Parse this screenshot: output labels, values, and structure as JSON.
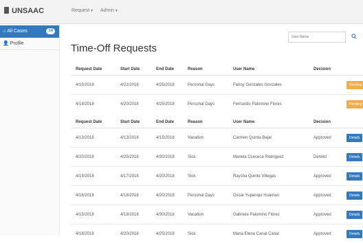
{
  "app": {
    "name": "UNSAAC"
  },
  "nav": {
    "menus": [
      "Request",
      "Admin"
    ]
  },
  "sidebar": {
    "items": [
      {
        "label": "All Cases",
        "badge": "14",
        "icon": "home-icon"
      },
      {
        "label": "Profile",
        "icon": "user-icon"
      }
    ]
  },
  "search": {
    "placeholder": "User Name"
  },
  "page": {
    "title": "Time-Off Requests"
  },
  "columns": [
    "Request Date",
    "Start Date",
    "End Date",
    "Reason",
    "User Name",
    "Decision"
  ],
  "pending_rows": [
    {
      "request": "4/15/2018",
      "start": "4/21/2018",
      "end": "4/25/2018",
      "reason": "Personal Days",
      "user": "Fanny Gonzales Gonzales",
      "decision": "",
      "action": "Pending"
    },
    {
      "request": "4/18/2018",
      "start": "4/20/2018",
      "end": "4/25/2018",
      "reason": "Personal Days",
      "user": "Fernando Palomino Flores",
      "decision": "",
      "action": "Pending"
    }
  ],
  "past_rows": [
    {
      "request": "4/13/2018",
      "start": "4/13/2018",
      "end": "4/15/2018",
      "reason": "Vacation",
      "user": "Carmen Quinta Bejar",
      "decision": "Approved",
      "action": "Details"
    },
    {
      "request": "4/20/2018",
      "start": "4/25/2018",
      "end": "4/30/2018",
      "reason": "Sick",
      "user": "Manela Ccececa Rodriguez",
      "decision": "Denied",
      "action": "Details"
    },
    {
      "request": "4/15/2018",
      "start": "4/17/2018",
      "end": "4/20/2018",
      "reason": "Sick",
      "user": "Raysha Quinte Villegas",
      "decision": "Approved",
      "action": "Details"
    },
    {
      "request": "4/16/2018",
      "start": "4/18/2018",
      "end": "4/20/2018",
      "reason": "Personal Days",
      "user": "Oscar Yupanqui Huaman",
      "decision": "Approved",
      "action": "Details"
    },
    {
      "request": "4/15/2018",
      "start": "4/19/2018",
      "end": "4/30/2018",
      "reason": "Vacation",
      "user": "Gabriela Palomino Flores",
      "decision": "Approved",
      "action": "Details"
    },
    {
      "request": "4/18/2018",
      "start": "4/20/2018",
      "end": "4/25/2018",
      "reason": "Sick",
      "user": "Maria Elena Canal Canal",
      "decision": "Approved",
      "action": "Details"
    }
  ],
  "colors": {
    "primary": "#3379c0",
    "pending": "#f0ad4e"
  }
}
